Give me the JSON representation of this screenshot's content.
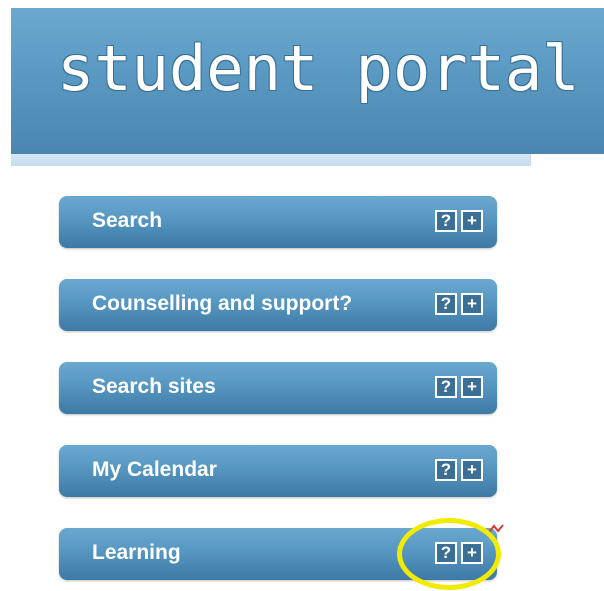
{
  "banner": {
    "title": "student portal"
  },
  "panels": [
    {
      "label": "Search",
      "help_glyph": "?",
      "expand_glyph": "+"
    },
    {
      "label": "Counselling and support?",
      "help_glyph": "?",
      "expand_glyph": "+"
    },
    {
      "label": "Search sites",
      "help_glyph": "?",
      "expand_glyph": "+"
    },
    {
      "label": "My Calendar",
      "help_glyph": "?",
      "expand_glyph": "+"
    },
    {
      "label": "Learning",
      "help_glyph": "?",
      "expand_glyph": "+"
    }
  ],
  "annotation": {
    "highlight_color": "#f2ea00",
    "target": "Learning panel controls"
  },
  "colors": {
    "banner": "#5a99c2",
    "panel": "#5899c3",
    "button_fill": "#3b6f96"
  }
}
